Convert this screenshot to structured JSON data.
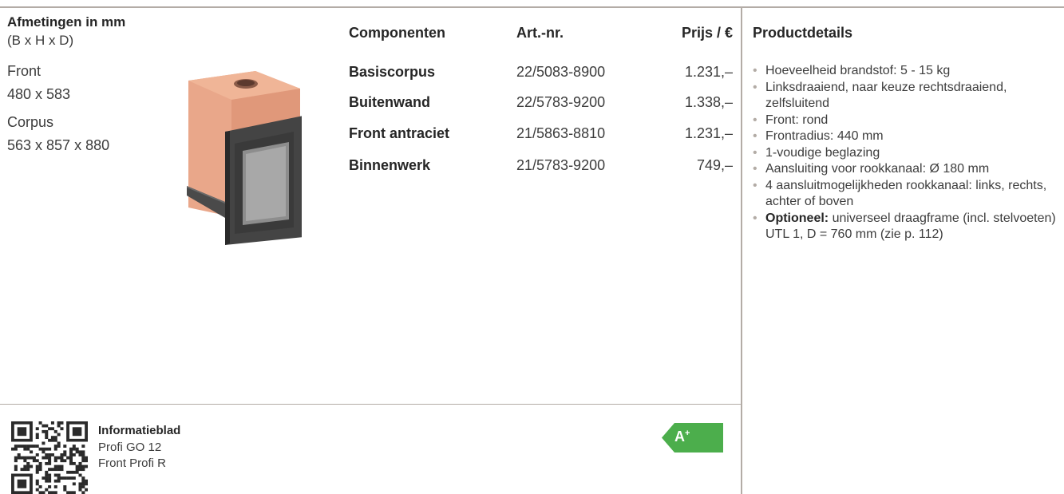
{
  "dimensions": {
    "heading": "Afmetingen in mm",
    "subheading": "(B x H x D)",
    "front_label": "Front",
    "front_value": "480 x 583",
    "corpus_label": "Corpus",
    "corpus_value": "563 x 857 x 880"
  },
  "table": {
    "headers": {
      "components": "Componenten",
      "article": "Art.-nr.",
      "price": "Prijs / €"
    },
    "rows": [
      {
        "name": "Basiscorpus",
        "article": "22/5083-8900",
        "price": "1.231,–"
      },
      {
        "name": "Buitenwand",
        "article": "22/5783-9200",
        "price": "1.338,–"
      },
      {
        "name": "Front antraciet",
        "article": "21/5863-8810",
        "price": "1.231,–"
      },
      {
        "name": "Binnenwerk",
        "article": "21/5783-9200",
        "price": "749,–"
      }
    ]
  },
  "details": {
    "heading": "Productdetails",
    "items": [
      "Hoeveelheid brandstof: 5 - 15 kg",
      "Linksdraaiend, naar keuze rechtsdraaiend, zelfsluitend",
      "Front: rond",
      "Frontradius: 440 mm",
      "1-voudige beglazing",
      "Aansluiting voor rookkanaal: Ø 180 mm",
      "4 aansluitmogelijkheden rookkanaal: links, rechts, achter of boven"
    ],
    "optional_label": "Optioneel:",
    "optional_text": "universeel draagframe (incl. stelvoeten) UTL 1, D = 760 mm (zie p. 112)"
  },
  "info": {
    "title": "Informatieblad",
    "line1": "Profi GO 12",
    "line2": "Front Profi R"
  },
  "energy": {
    "label": "A",
    "sup": "+",
    "color": "#4cae4c"
  },
  "icons": {
    "product_image": "stove-image",
    "qr": "qr-code-icon"
  }
}
